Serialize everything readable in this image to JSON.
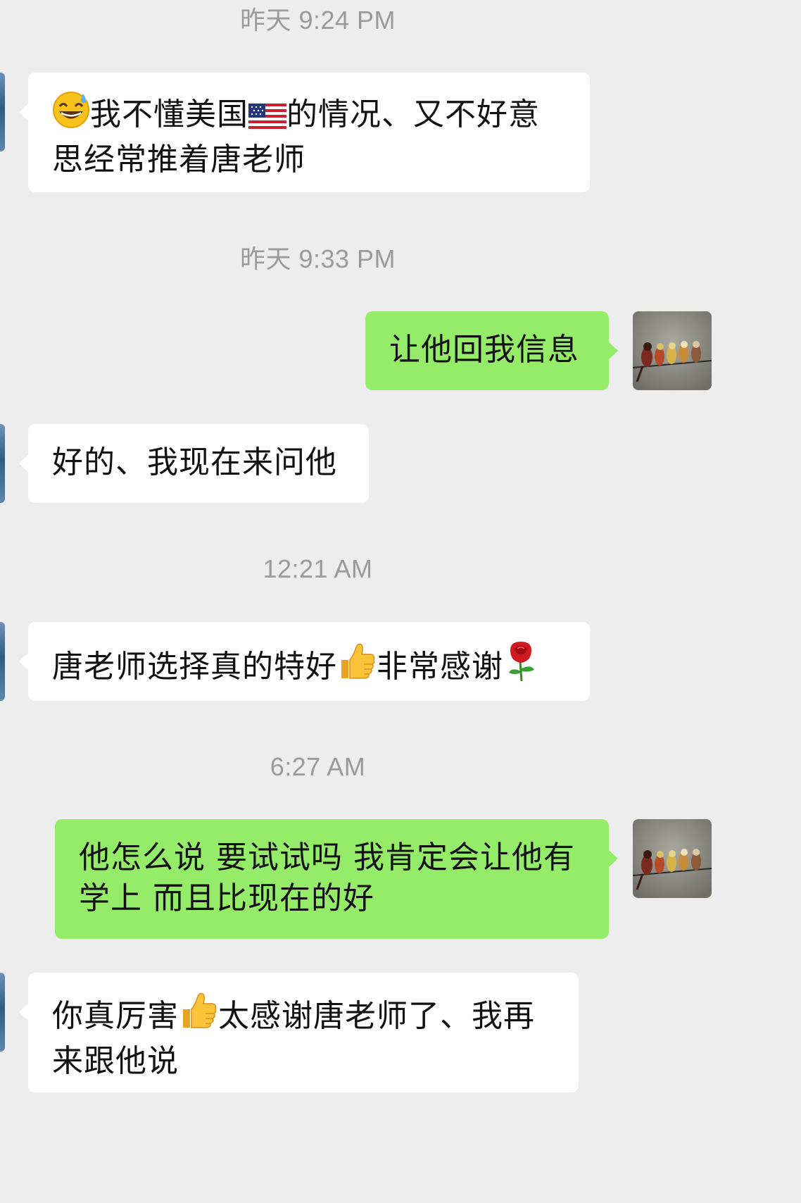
{
  "timestamps": [
    "昨天 9:24 PM",
    "昨天 9:33 PM",
    "12:21 AM",
    "6:27 AM"
  ],
  "messages": [
    {
      "side": "in",
      "parts": {
        "a": "我不懂美国",
        "b": "的情况、又不好意",
        "c": "思经常推着唐老师"
      },
      "emojis": [
        "grinning-sweat-icon",
        "us-flag-icon"
      ]
    },
    {
      "side": "out",
      "text": "让他回我信息"
    },
    {
      "side": "in",
      "text": "好的、我现在来问他"
    },
    {
      "side": "in",
      "parts": {
        "a": "唐老师选择真的特好",
        "b": "非常感谢"
      },
      "emojis": [
        "thumbs-up-icon",
        "rose-icon"
      ]
    },
    {
      "side": "out",
      "parts": {
        "a": "他怎么说 要试试吗 我肯定会让他有",
        "b": "学上 而且比现在的好"
      }
    },
    {
      "side": "in",
      "parts": {
        "a": "你真厉害",
        "b": "太感谢唐老师了、我再",
        "c": "来跟他说"
      },
      "emojis": [
        "thumbs-up-icon"
      ]
    }
  ],
  "colors": {
    "background": "#ededed",
    "incoming_bubble": "#ffffff",
    "outgoing_bubble": "#95ec69",
    "timestamp_text": "#9a9a9a"
  }
}
